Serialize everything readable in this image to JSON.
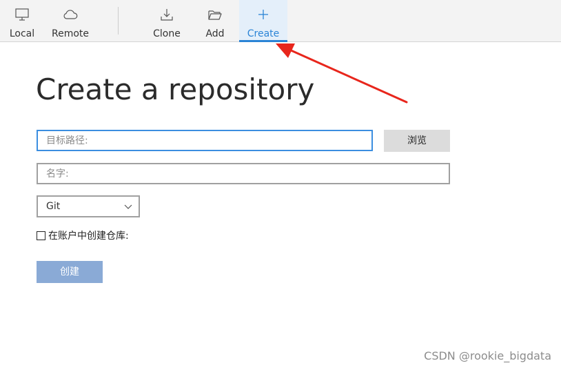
{
  "toolbar": {
    "items": [
      {
        "label": "Local",
        "icon": "monitor-icon"
      },
      {
        "label": "Remote",
        "icon": "cloud-icon"
      },
      {
        "label": "Clone",
        "icon": "download-icon"
      },
      {
        "label": "Add",
        "icon": "folder-open-icon"
      },
      {
        "label": "Create",
        "icon": "plus-icon"
      }
    ],
    "active": "Create",
    "accent_color": "#2b84d6"
  },
  "main": {
    "title": "Create a repository",
    "path_placeholder": "目标路径:",
    "browse_label": "浏览",
    "name_placeholder": "名字:",
    "vcs_selected": "Git",
    "create_in_account_label": "在账户中创建仓库:",
    "create_in_account_checked": false,
    "create_button_label": "创建",
    "create_button_color": "#8aaad6"
  },
  "annotation": {
    "arrow_color": "#e8261c"
  },
  "watermark": "CSDN @rookie_bigdata"
}
